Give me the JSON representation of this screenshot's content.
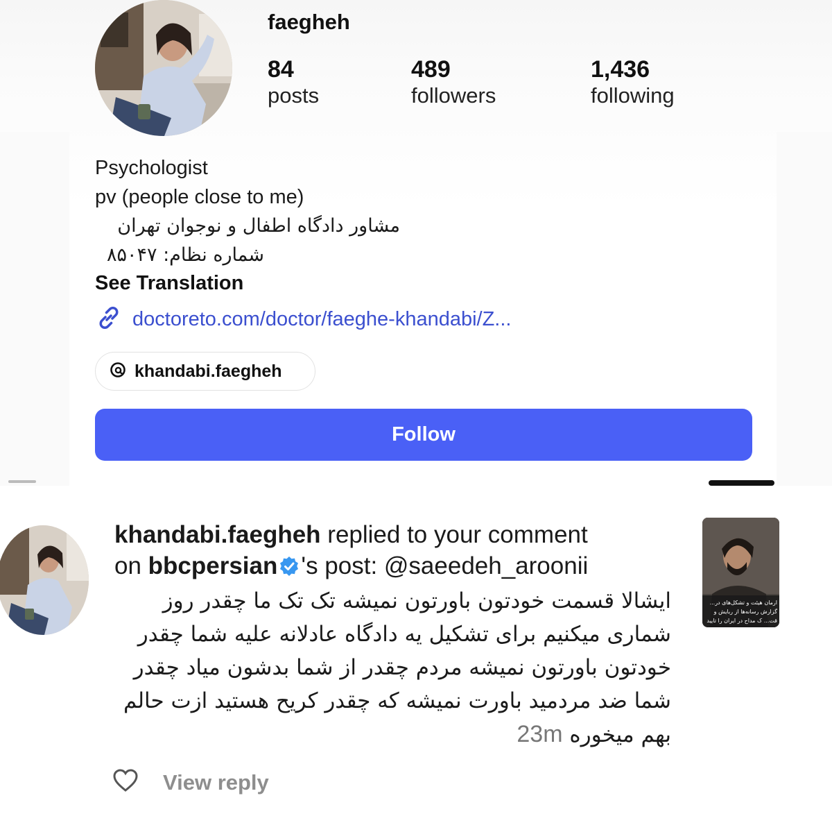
{
  "profile": {
    "username": "faegheh",
    "stats": [
      {
        "value": "84",
        "label": "posts"
      },
      {
        "value": "489",
        "label": "followers"
      },
      {
        "value": "1,436",
        "label": "following"
      }
    ],
    "bio": {
      "line1": "Psychologist",
      "line2": "pv (people close to me)",
      "line3": "مشاور دادگاه اطفال و نوجوان تهران",
      "line4": "شماره نظام: ۸۵۰۴۷"
    },
    "see_translation": "See Translation",
    "link": "doctoreto.com/doctor/faeghe-khandabi/Z...",
    "threads_handle": "khandabi.faegheh",
    "follow_label": "Follow"
  },
  "notification": {
    "actor": "khandabi.faegheh",
    "action": " replied to your comment",
    "on": "on ",
    "account": "bbcpersian",
    "post_suffix": "'s post: @saeedeh_aroonii",
    "comment_text": "ایشالا قسمت خودتون باورتون نمیشه تک تک ما چقدر روز شماری میکنیم برای تشکیل یه دادگاه عادلانه علیه شما چقدر خودتون باورتون نمیشه مردم چقدر از شما بدشون میاد چقدر شما ضد مردمید باورت نمیشه که چقدر کریح هستید ازت حالم بهم میخوره",
    "time": "23m",
    "view_reply": "View reply",
    "thumbnail_text": "ارمان هیئت و تشکل‌های در... گزارش رسانه‌ها از ربایش و قت... ک مداح در ایران را تایید کر..."
  },
  "colors": {
    "follow_button": "#4a60f6",
    "link": "#3b4fcf",
    "verified_badge": "#3897f0"
  }
}
